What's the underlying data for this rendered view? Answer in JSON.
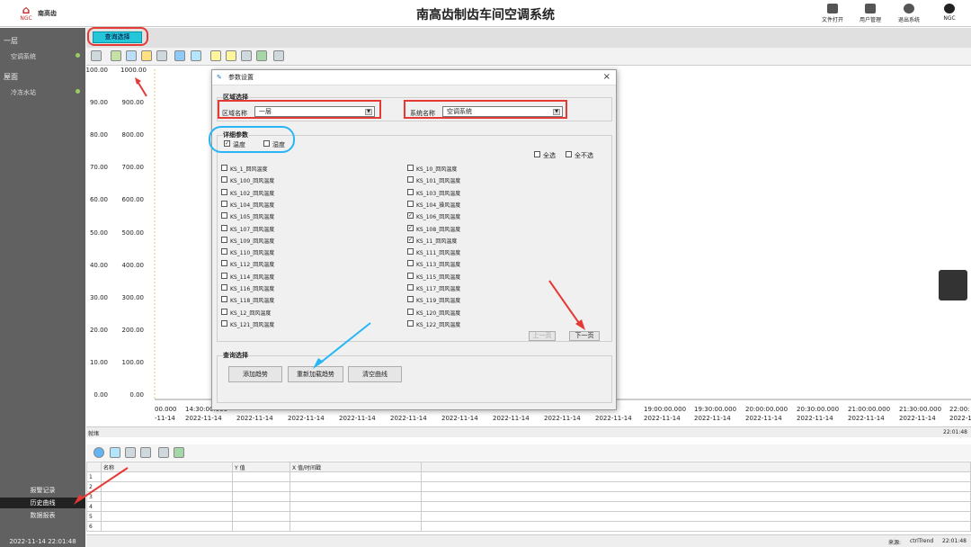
{
  "header": {
    "logo_mark": "⌂",
    "logo_text": "NGC",
    "brand": "南高齿",
    "title": "南高齿制齿车间空调系统",
    "buttons": [
      {
        "label": "文件打开",
        "icon": "folder-icon"
      },
      {
        "label": "用户管理",
        "icon": "user-icon"
      },
      {
        "label": "退出系统",
        "icon": "power-icon"
      },
      {
        "label": "NGC",
        "icon": "info-icon"
      }
    ]
  },
  "sidebar": {
    "groups": [
      {
        "title": "一层",
        "item": "空调系统"
      },
      {
        "title": "屋面",
        "item": "冷冻水站"
      }
    ],
    "bottom": [
      "报警记录",
      "历史曲线",
      "数据报表"
    ],
    "active": "历史曲线",
    "datetime": "2022-11-14  22:01:48"
  },
  "tabs": {
    "query": "查询选择"
  },
  "chart": {
    "left_ticks": [
      "100.00",
      "90.00",
      "80.00",
      "70.00",
      "60.00",
      "50.00",
      "40.00",
      "30.00",
      "20.00",
      "10.00",
      "0.00"
    ],
    "right_ticks": [
      "1000.00",
      "900.00",
      "800.00",
      "700.00",
      "600.00",
      "500.00",
      "400.00",
      "300.00",
      "200.00",
      "100.00",
      "0.00"
    ],
    "x_times": [
      "00.000",
      "14:30:00.000",
      "19:00:00.000",
      "19:30:00.000",
      "20:00:00.000",
      "20:30:00.000",
      "21:00:00.000",
      "21:30:00.000",
      "22:00:"
    ],
    "x_date": "2022-11-14",
    "x_date_partial": "-11-14",
    "status_left": "就绪",
    "status_right": "22:01:48"
  },
  "grid": {
    "headers": [
      "名称",
      "Y 值",
      "X 值/时间戳"
    ],
    "rows": [
      "1",
      "2",
      "3",
      "4",
      "5",
      "6"
    ],
    "status_source": "来源:",
    "status_app": "ctrlTrend",
    "status_time": "22:01:48"
  },
  "dialog": {
    "title": "参数设置",
    "close": "×",
    "area_group": "区域选择",
    "area_label": "区域名称",
    "area_value": "一层",
    "system_label": "系统名称",
    "system_value": "空调系统",
    "param_group": "详细参数",
    "type_temp": "温度",
    "type_humid": "湿度",
    "select_all": "全选",
    "select_none": "全不选",
    "left_params": [
      {
        "label": "KS_1_回风温度",
        "checked": false
      },
      {
        "label": "KS_100_回风温度",
        "checked": false
      },
      {
        "label": "KS_102_回风温度",
        "checked": false
      },
      {
        "label": "KS_104_回风温度",
        "checked": false
      },
      {
        "label": "KS_105_回风温度",
        "checked": false
      },
      {
        "label": "KS_107_回风温度",
        "checked": false
      },
      {
        "label": "KS_109_回风温度",
        "checked": false
      },
      {
        "label": "KS_110_回风温度",
        "checked": false
      },
      {
        "label": "KS_112_回风温度",
        "checked": false
      },
      {
        "label": "KS_114_回风温度",
        "checked": false
      },
      {
        "label": "KS_116_回风温度",
        "checked": false
      },
      {
        "label": "KS_118_回风温度",
        "checked": false
      },
      {
        "label": "KS_12_回风温度",
        "checked": false
      },
      {
        "label": "KS_121_回风温度",
        "checked": false
      }
    ],
    "right_params": [
      {
        "label": "KS_10_回风温度",
        "checked": false
      },
      {
        "label": "KS_101_回风温度",
        "checked": false
      },
      {
        "label": "KS_103_回风温度",
        "checked": false
      },
      {
        "label": "KS_104_操风温度",
        "checked": false
      },
      {
        "label": "KS_106_回风温度",
        "checked": true
      },
      {
        "label": "KS_108_回风温度",
        "checked": true
      },
      {
        "label": "KS_11_回风温度",
        "checked": true
      },
      {
        "label": "KS_111_回风温度",
        "checked": false
      },
      {
        "label": "KS_113_回风温度",
        "checked": false
      },
      {
        "label": "KS_115_回风温度",
        "checked": false
      },
      {
        "label": "KS_117_回风温度",
        "checked": false
      },
      {
        "label": "KS_119_回风温度",
        "checked": false
      },
      {
        "label": "KS_120_回风温度",
        "checked": false
      },
      {
        "label": "KS_122_回风温度",
        "checked": false
      }
    ],
    "prev_page": "上一页",
    "next_page": "下一页",
    "query_group": "查询选择",
    "add_trend": "添加趋势",
    "reload_trend": "重新加载趋势",
    "clear_curve": "清空曲线"
  },
  "colors": {
    "sidebar": "#616161",
    "tab_active": "#26c6da",
    "highlight_red": "#e53935",
    "highlight_blue": "#29b6f6"
  }
}
